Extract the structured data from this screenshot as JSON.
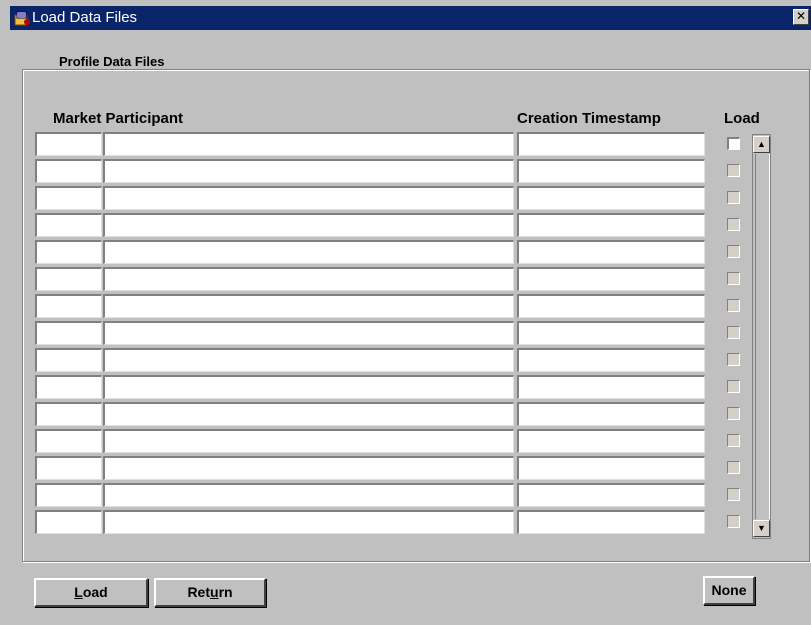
{
  "window": {
    "title": "Load Data Files",
    "close_glyph": "✕",
    "icon": "forms-app-icon"
  },
  "frame": {
    "title": "Profile Data Files"
  },
  "columns": {
    "market_participant": "Market Participant",
    "creation_timestamp": "Creation Timestamp",
    "load": "Load"
  },
  "rows": [
    {
      "code": "",
      "participant": "",
      "timestamp": "",
      "load": false,
      "enabled": true
    },
    {
      "code": "",
      "participant": "",
      "timestamp": "",
      "load": false,
      "enabled": false
    },
    {
      "code": "",
      "participant": "",
      "timestamp": "",
      "load": false,
      "enabled": false
    },
    {
      "code": "",
      "participant": "",
      "timestamp": "",
      "load": false,
      "enabled": false
    },
    {
      "code": "",
      "participant": "",
      "timestamp": "",
      "load": false,
      "enabled": false
    },
    {
      "code": "",
      "participant": "",
      "timestamp": "",
      "load": false,
      "enabled": false
    },
    {
      "code": "",
      "participant": "",
      "timestamp": "",
      "load": false,
      "enabled": false
    },
    {
      "code": "",
      "participant": "",
      "timestamp": "",
      "load": false,
      "enabled": false
    },
    {
      "code": "",
      "participant": "",
      "timestamp": "",
      "load": false,
      "enabled": false
    },
    {
      "code": "",
      "participant": "",
      "timestamp": "",
      "load": false,
      "enabled": false
    },
    {
      "code": "",
      "participant": "",
      "timestamp": "",
      "load": false,
      "enabled": false
    },
    {
      "code": "",
      "participant": "",
      "timestamp": "",
      "load": false,
      "enabled": false
    },
    {
      "code": "",
      "participant": "",
      "timestamp": "",
      "load": false,
      "enabled": false
    },
    {
      "code": "",
      "participant": "",
      "timestamp": "",
      "load": false,
      "enabled": false
    },
    {
      "code": "",
      "participant": "",
      "timestamp": "",
      "load": false,
      "enabled": false
    }
  ],
  "scrollbar": {
    "up_glyph": "▲",
    "down_glyph": "▼"
  },
  "buttons": {
    "load": {
      "pre": "",
      "mnemonic": "L",
      "post": "oad"
    },
    "return": {
      "pre": "Ret",
      "mnemonic": "u",
      "post": "rn"
    },
    "none": "None"
  },
  "colors": {
    "titlebar": "#0a246a",
    "background": "#c0c0c0",
    "field": "#ffffff"
  }
}
